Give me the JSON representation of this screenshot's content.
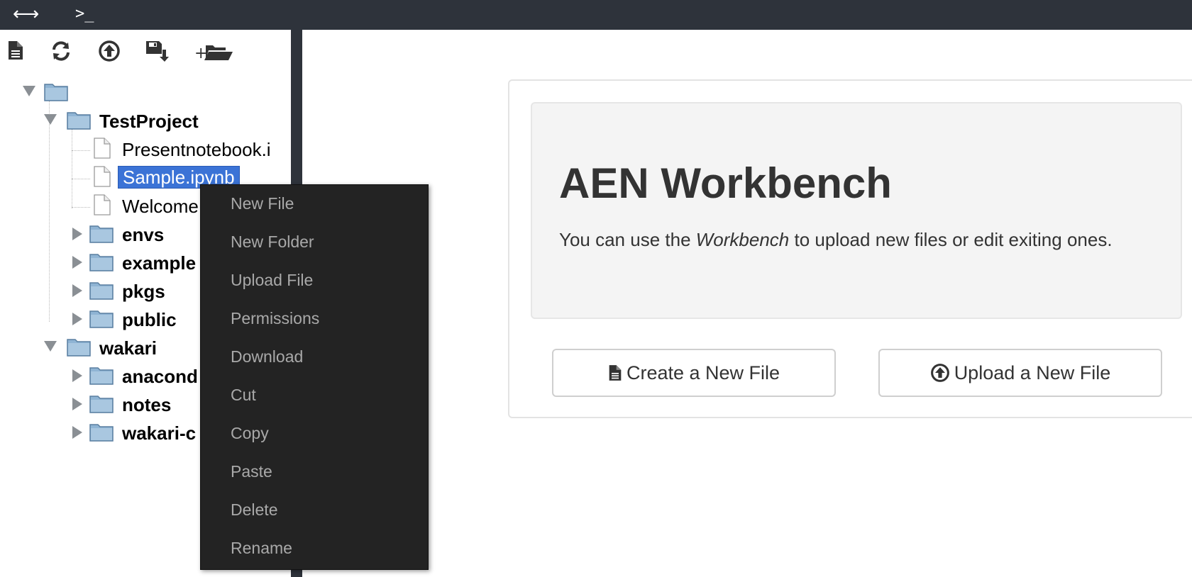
{
  "topbar": {
    "icons": [
      "expand-arrows-icon",
      "terminal-icon"
    ],
    "expand_glyph": "⟷",
    "terminal_glyph": ">_"
  },
  "sidebar": {
    "toolbar": [
      "new-file-icon",
      "refresh-icon",
      "upload-icon",
      "save-download-icon",
      "new-folder-icon"
    ],
    "tree": {
      "root": {
        "label": ""
      },
      "testproject": {
        "label": "TestProject",
        "children": [
          "Presentnotebook.i",
          "Sample.ipynb",
          "Welcome.",
          "envs",
          "example",
          "pkgs",
          "public"
        ]
      },
      "wakari": {
        "label": "wakari",
        "children": [
          "anacond",
          "notes",
          "wakari-c"
        ]
      },
      "selected": "Sample.ipynb"
    }
  },
  "context_menu": {
    "items": [
      "New File",
      "New Folder",
      "Upload File",
      "Permissions",
      "Download",
      "Cut",
      "Copy",
      "Paste",
      "Delete",
      "Rename"
    ]
  },
  "main": {
    "title": "AEN Workbench",
    "text_before": "You can use the ",
    "text_em": "Workbench",
    "text_after": " to upload new files or edit exiting ones.",
    "create_button": "Create a New File",
    "upload_button": "Upload a New File"
  },
  "colors": {
    "topbar": "#2e333b",
    "selection": "#3b73d6",
    "menu_bg": "#232323",
    "menu_text": "#a9a9a9",
    "folder": "#8fb4d4"
  }
}
